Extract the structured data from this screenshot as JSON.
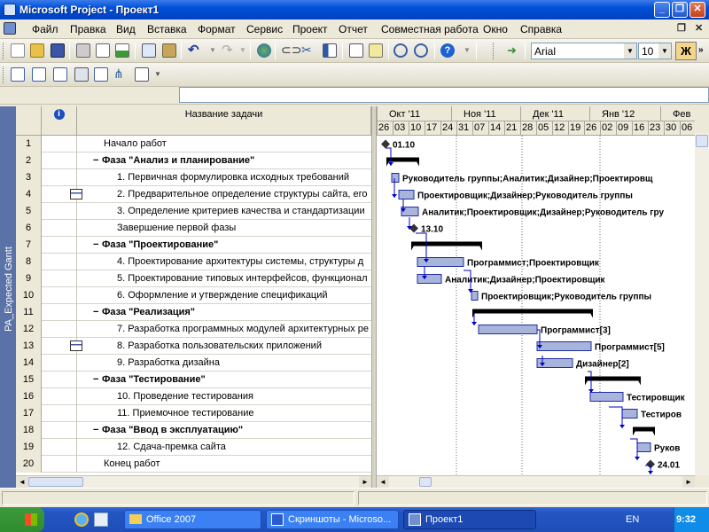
{
  "window": {
    "title": "Microsoft Project - Проект1"
  },
  "menu": [
    "Файл",
    "Правка",
    "Вид",
    "Вставка",
    "Формат",
    "Сервис",
    "Проект",
    "Отчет",
    "Совместная работа",
    "Окно",
    "Справка"
  ],
  "format": {
    "font": "Arial",
    "size": "10",
    "bold_label": "Ж"
  },
  "view_bar": {
    "label": "PA_Expected Gantt"
  },
  "table": {
    "indicator_header": "i",
    "name_header": "Название задачи",
    "rows": [
      {
        "id": "1",
        "name": "Начало работ",
        "summary": false,
        "indent": 0,
        "note": false
      },
      {
        "id": "2",
        "name": "Фаза \"Анализ и планирование\"",
        "summary": true,
        "indent": 0,
        "note": false
      },
      {
        "id": "3",
        "name": "1. Первичная формулировка исходных требований",
        "summary": false,
        "indent": 1,
        "note": false
      },
      {
        "id": "4",
        "name": "2. Предварительное определение структуры сайта, его",
        "summary": false,
        "indent": 1,
        "note": true
      },
      {
        "id": "5",
        "name": "3. Определение критериев качества и стандартизации",
        "summary": false,
        "indent": 1,
        "note": false
      },
      {
        "id": "6",
        "name": "Завершение первой фазы",
        "summary": false,
        "indent": 1,
        "note": false
      },
      {
        "id": "7",
        "name": "Фаза \"Проектирование\"",
        "summary": true,
        "indent": 0,
        "note": false
      },
      {
        "id": "8",
        "name": "4. Проектирование архитектуры системы, структуры д",
        "summary": false,
        "indent": 1,
        "note": false
      },
      {
        "id": "9",
        "name": "5. Проектирование типовых интерфейсов, функционал",
        "summary": false,
        "indent": 1,
        "note": false
      },
      {
        "id": "10",
        "name": "6. Оформление и утверждение спецификаций",
        "summary": false,
        "indent": 1,
        "note": false
      },
      {
        "id": "11",
        "name": "Фаза \"Реализация\"",
        "summary": true,
        "indent": 0,
        "note": false
      },
      {
        "id": "12",
        "name": "7. Разработка программных модулей архитектурных ре",
        "summary": false,
        "indent": 1,
        "note": false
      },
      {
        "id": "13",
        "name": "8. Разработка пользовательских приложений",
        "summary": false,
        "indent": 1,
        "note": true
      },
      {
        "id": "14",
        "name": "9. Разработка дизайна",
        "summary": false,
        "indent": 1,
        "note": false
      },
      {
        "id": "15",
        "name": "Фаза \"Тестирование\"",
        "summary": true,
        "indent": 0,
        "note": false
      },
      {
        "id": "16",
        "name": "10. Проведение тестирования",
        "summary": false,
        "indent": 1,
        "note": false
      },
      {
        "id": "17",
        "name": "11. Приемочное тестирование",
        "summary": false,
        "indent": 1,
        "note": false
      },
      {
        "id": "18",
        "name": "Фаза \"Ввод в эксплуатацию\"",
        "summary": true,
        "indent": 0,
        "note": false
      },
      {
        "id": "19",
        "name": "12. Сдача-премка сайта",
        "summary": false,
        "indent": 1,
        "note": false
      },
      {
        "id": "20",
        "name": "Конец работ",
        "summary": false,
        "indent": 0,
        "note": false
      }
    ]
  },
  "timescale": {
    "months": [
      "Окт '11",
      "Ноя '11",
      "Дек '11",
      "Янв '12",
      "Фев '"
    ],
    "days": [
      "26",
      "03",
      "10",
      "17",
      "24",
      "31",
      "07",
      "14",
      "21",
      "28",
      "05",
      "12",
      "19",
      "26",
      "02",
      "09",
      "16",
      "23",
      "30",
      "06"
    ]
  },
  "gantt": {
    "labels": {
      "r1": "01.10",
      "r3": "Руководитель группы;Аналитик;Дизайнер;Проектировщ",
      "r4": "Проектировщик;Дизайнер;Руководитель группы",
      "r5": "Аналитик;Проектировщик;Дизайнер;Руководитель гру",
      "r6": "13.10",
      "r8": "Программист;Проектировщик",
      "r9": "Аналитик;Дизайнер;Проектировщик",
      "r10": "Проектировщик;Руководитель группы",
      "r12": "Программист[3]",
      "r13": "Программист[5]",
      "r14": "Дизайнер[2]",
      "r16": "Тестировщик",
      "r17": "Тестиров",
      "r19": "Руков",
      "r20": "24.01"
    },
    "colors": {
      "task_fill": "#a9b4dd",
      "task_border": "#1e2f9c",
      "summary": "#000000",
      "link": "#0000c8"
    }
  },
  "taskbar": {
    "buttons": [
      "Office 2007",
      "Скриншоты - Microso...",
      "Проект1"
    ],
    "lang": "EN",
    "time": "9:32"
  }
}
